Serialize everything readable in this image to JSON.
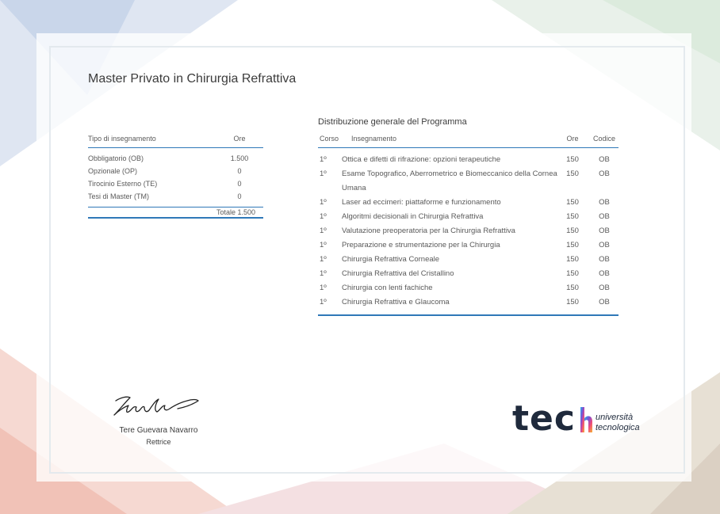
{
  "document": {
    "title": "Master Privato in Chirurgia Refrattiva"
  },
  "summary_table": {
    "col_type": "Tipo di insegnamento",
    "col_hours": "Ore",
    "rows": [
      {
        "type": "Obbligatorio (OB)",
        "hours": "1.500"
      },
      {
        "type": "Opzionale (OP)",
        "hours": "0"
      },
      {
        "type": "Tirocinio Esterno (TE)",
        "hours": "0"
      },
      {
        "type": "Tesi di Master (TM)",
        "hours": "0"
      }
    ],
    "total": "Totale 1.500"
  },
  "program_table": {
    "title": "Distribuzione generale del Programma",
    "col_year": "Corso",
    "col_subject": "Insegnamento",
    "col_hours": "Ore",
    "col_code": "Codice",
    "rows": [
      {
        "year": "1º",
        "subject": "Ottica e difetti di rifrazione: opzioni terapeutiche",
        "hours": "150",
        "code": "OB"
      },
      {
        "year": "1º",
        "subject": "Esame Topografico, Aberrometrico e Biomeccanico della Cornea Umana",
        "hours": "150",
        "code": "OB"
      },
      {
        "year": "1º",
        "subject": "Laser ad eccimeri: piattaforme e funzionamento",
        "hours": "150",
        "code": "OB"
      },
      {
        "year": "1º",
        "subject": "Algoritmi decisionali in Chirurgia Refrattiva",
        "hours": "150",
        "code": "OB"
      },
      {
        "year": "1º",
        "subject": "Valutazione preoperatoria per la Chirurgia Refrattiva",
        "hours": "150",
        "code": "OB"
      },
      {
        "year": "1º",
        "subject": "Preparazione e strumentazione per la Chirurgia",
        "hours": "150",
        "code": "OB"
      },
      {
        "year": "1º",
        "subject": "Chirurgia Refrattiva Corneale",
        "hours": "150",
        "code": "OB"
      },
      {
        "year": "1º",
        "subject": "Chirurgia Refrattiva del Cristallino",
        "hours": "150",
        "code": "OB"
      },
      {
        "year": "1º",
        "subject": "Chirurgia con lenti fachiche",
        "hours": "150",
        "code": "OB"
      },
      {
        "year": "1º",
        "subject": "Chirurgia Refrattiva e Glaucoma",
        "hours": "150",
        "code": "OB"
      }
    ]
  },
  "signature": {
    "name": "Tere Guevara Navarro",
    "role": "Rettrice"
  },
  "logo": {
    "brand": "tec",
    "line1": "università",
    "line2": "tecnologica"
  }
}
